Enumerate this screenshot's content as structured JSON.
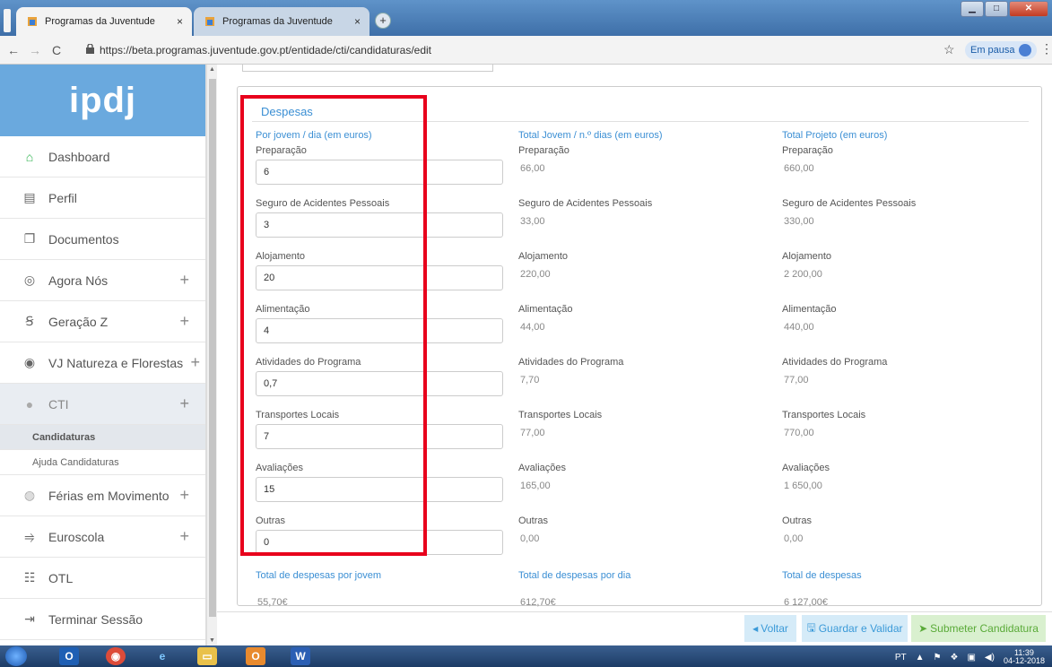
{
  "browser": {
    "tabs": [
      {
        "title": "Programas da Juventude",
        "active": true
      },
      {
        "title": "Programas da Juventude",
        "active": false
      }
    ],
    "new_tab": "+",
    "url": "https://beta.programas.juventude.gov.pt/entidade/cti/candidaturas/edit",
    "profile_label": "Em pausa"
  },
  "sidebar": {
    "logo": "ipdj",
    "items": [
      {
        "label": "Dashboard",
        "icon": "home-icon",
        "expandable": false
      },
      {
        "label": "Perfil",
        "icon": "id-card-icon",
        "expandable": false
      },
      {
        "label": "Documentos",
        "icon": "documents-icon",
        "expandable": false
      },
      {
        "label": "Agora Nós",
        "icon": "agora-nos-icon",
        "expandable": true
      },
      {
        "label": "Geração Z",
        "icon": "geracao-z-icon",
        "expandable": true
      },
      {
        "label": "VJ Natureza e Florestas",
        "icon": "tree-icon",
        "expandable": true
      },
      {
        "label": "CTI",
        "icon": "cti-icon",
        "expandable": true
      }
    ],
    "cti_sub": [
      {
        "label": "Candidaturas",
        "active": true
      },
      {
        "label": "Ajuda Candidaturas",
        "active": false
      }
    ],
    "items_after": [
      {
        "label": "Férias em Movimento",
        "icon": "ferias-icon",
        "expandable": true
      },
      {
        "label": "Euroscola",
        "icon": "euroscola-icon",
        "expandable": true
      },
      {
        "label": "OTL",
        "icon": "otl-icon",
        "expandable": false
      },
      {
        "label": "Terminar Sessão",
        "icon": "logout-icon",
        "expandable": false
      }
    ],
    "plus": "+"
  },
  "despesas": {
    "title": "Despesas",
    "col_headers": [
      "Por jovem / dia (em euros)",
      "Total Jovem / n.º dias (em euros)",
      "Total Projeto (em euros)"
    ],
    "rows": [
      {
        "label": "Preparação",
        "input": "6",
        "total_jovem": "66,00",
        "total_projeto": "660,00"
      },
      {
        "label": "Seguro de Acidentes Pessoais",
        "input": "3",
        "total_jovem": "33,00",
        "total_projeto": "330,00"
      },
      {
        "label": "Alojamento",
        "input": "20",
        "total_jovem": "220,00",
        "total_projeto": "2 200,00"
      },
      {
        "label": "Alimentação",
        "input": "4",
        "total_jovem": "44,00",
        "total_projeto": "440,00"
      },
      {
        "label": "Atividades do Programa",
        "input": "0,7",
        "total_jovem": "7,70",
        "total_projeto": "77,00"
      },
      {
        "label": "Transportes Locais",
        "input": "7",
        "total_jovem": "77,00",
        "total_projeto": "770,00"
      },
      {
        "label": "Avaliações",
        "input": "15",
        "total_jovem": "165,00",
        "total_projeto": "1 650,00"
      },
      {
        "label": "Outras",
        "input": "0",
        "total_jovem": "0,00",
        "total_projeto": "0,00"
      }
    ],
    "totals": [
      {
        "label": "Total de despesas por jovem",
        "value": "55,70€"
      },
      {
        "label": "Total de despesas por dia",
        "value": "612,70€"
      },
      {
        "label": "Total de despesas",
        "value": "6 127,00€"
      }
    ]
  },
  "footer": {
    "voltar": "Voltar",
    "guardar": "Guardar e Validar",
    "submeter": "Submeter Candidatura"
  },
  "taskbar": {
    "lang": "PT",
    "time": "11:39",
    "date": "04-12-2018"
  },
  "colors": {
    "accent": "#3b8fd4",
    "logo_bg": "#6aa9de",
    "highlight": "#e8001c",
    "submit": "#5aaa38"
  }
}
